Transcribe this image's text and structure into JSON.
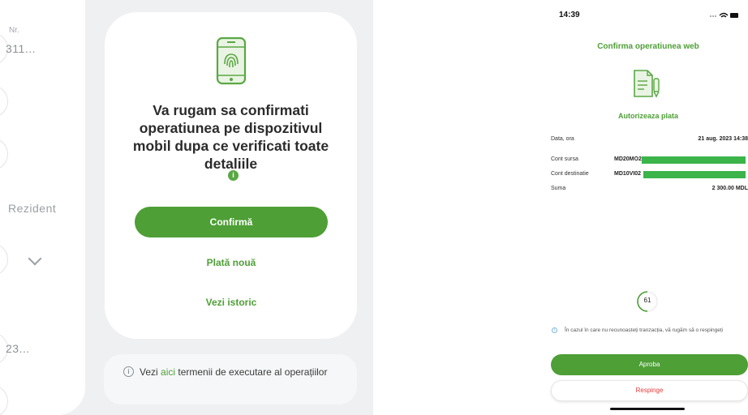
{
  "web": {
    "form": {
      "nr_label": "Nr.",
      "nr_value": "311...",
      "resident_label": "Rezident",
      "amount_value": "23..."
    },
    "modal": {
      "message": "Va rugam sa confirmati operatiunea pe dispozitivul mobil dupa ce verificati toate detaliile",
      "info_icon": "i",
      "confirm_label": "Confirmă",
      "new_payment_label": "Plată nouă",
      "history_label": "Vezi istoric"
    },
    "terms": {
      "prefix": "Vezi ",
      "link": "aici",
      "suffix": " termenii de executare al operațiilor"
    }
  },
  "phone": {
    "time": "14:39",
    "title": "Confirma operatiunea web",
    "subtitle": "Autorizeaza plata",
    "details": {
      "date_label": "Data, ora",
      "date_value": "21 aug. 2023 14:38",
      "source_label": "Cont sursa",
      "source_value": "MD20MO2",
      "dest_label": "Cont destinatie",
      "dest_value": "MD10VI02",
      "amount_label": "Suma",
      "amount_value": "2 300.00 MDL"
    },
    "timer": "61",
    "note": "În cazul în care nu recunoașteți tranzacția, vă rugăm să o respingeți",
    "approve_label": "Aproba",
    "reject_label": "Respinge"
  },
  "colors": {
    "accent_green": "#4e9f36",
    "reject_red": "#e23b3b",
    "redaction_green": "#3bb44a"
  },
  "icons": [
    "phone-fingerprint-icon",
    "info-icon",
    "document-signature-icon",
    "countdown-timer-icon",
    "signal-wifi-battery-icon"
  ]
}
